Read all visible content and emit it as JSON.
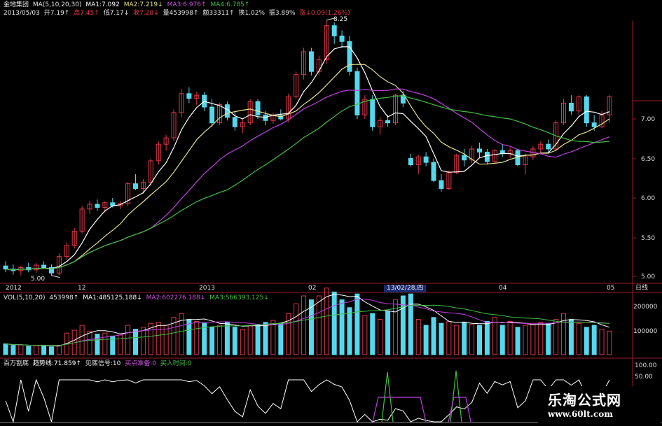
{
  "header": {
    "stock_name": "金地集团",
    "ma_spec": "MA(5,10,20,30)",
    "ma1": "MA1:7.092",
    "ma2": "MA2:7.219↓",
    "ma3": "MA3:6.976↑",
    "ma4": "MA4:6.785↑",
    "date": "2013/05/03",
    "open": "开7.19↑",
    "high": "高7.45↑",
    "low": "低7.17↓",
    "close": "收7.28↓",
    "volume": "量453998↑",
    "amount": "额33311↑",
    "turnover": "换1.02%",
    "amplitude": "振3.89%",
    "change": "涨↓0.09(1.26%)"
  },
  "price_chart": {
    "high_label": "8.25",
    "low_label": "5.00",
    "y_labels": [
      "7.00",
      "6.50",
      "6.00",
      "5.50",
      "5.00"
    ],
    "period_label": "日线"
  },
  "time_axis": {
    "labels": [
      "2012",
      "12",
      "2013",
      "02",
      "04",
      "05"
    ],
    "cursor_date": "13/02/28,四"
  },
  "volume_panel": {
    "spec": "VOL(5,10,20)",
    "value": "453998↑",
    "ma1": "MA1:485125.188↓",
    "ma2": "MA2:602276.188↓",
    "ma3": "MA3:566393.125↓",
    "y_labels": [
      "200000",
      "100000"
    ]
  },
  "indicator_panel": {
    "name": "百万割底",
    "trend": "趋势线:71.859↑",
    "signal": "见底信号:10",
    "buy_prep": "买点准备:0",
    "buy_time": "买入时间:0",
    "y_labels": [
      "100.00",
      "50.00"
    ]
  },
  "watermark": {
    "title": "乐淘公式网",
    "url": "www.60lt.com"
  },
  "colors": {
    "up": "#e0384a",
    "down": "#54d8ee",
    "ma1": "#ffffff",
    "ma2": "#e8e090",
    "ma3": "#c040e0",
    "ma4": "#40c040",
    "axis": "#9b1e28"
  },
  "chart_data": {
    "type": "candlestick",
    "series": [
      {
        "name": "K",
        "values": [
          [
            5.14,
            5.2,
            5.06,
            5.1
          ],
          [
            5.1,
            5.16,
            5.03,
            5.08
          ],
          [
            5.08,
            5.14,
            5.02,
            5.12
          ],
          [
            5.12,
            5.18,
            5.06,
            5.09
          ],
          [
            5.09,
            5.18,
            5.05,
            5.15
          ],
          [
            5.15,
            5.2,
            5.1,
            5.12
          ],
          [
            5.12,
            5.16,
            5.02,
            5.05
          ],
          [
            5.05,
            5.3,
            5.02,
            5.26
          ],
          [
            5.26,
            5.44,
            5.22,
            5.4
          ],
          [
            5.4,
            5.62,
            5.36,
            5.58
          ],
          [
            5.58,
            5.9,
            5.55,
            5.86
          ],
          [
            5.86,
            5.96,
            5.8,
            5.92
          ],
          [
            5.92,
            5.98,
            5.84,
            5.88
          ],
          [
            5.88,
            5.96,
            5.82,
            5.94
          ],
          [
            5.94,
            6.0,
            5.88,
            5.9
          ],
          [
            5.9,
            5.96,
            5.86,
            5.93
          ],
          [
            5.93,
            6.2,
            5.9,
            6.18
          ],
          [
            6.18,
            6.3,
            6.1,
            6.12
          ],
          [
            6.12,
            6.24,
            6.05,
            6.2
          ],
          [
            6.2,
            6.5,
            6.15,
            6.47
          ],
          [
            6.47,
            6.72,
            6.42,
            6.68
          ],
          [
            6.68,
            6.8,
            6.6,
            6.76
          ],
          [
            6.76,
            7.12,
            6.72,
            7.08
          ],
          [
            7.08,
            7.38,
            7.02,
            7.32
          ],
          [
            7.32,
            7.4,
            7.2,
            7.26
          ],
          [
            7.26,
            7.34,
            7.18,
            7.3
          ],
          [
            7.3,
            7.34,
            7.1,
            7.15
          ],
          [
            7.15,
            7.25,
            6.9,
            6.95
          ],
          [
            6.95,
            7.2,
            6.92,
            7.18
          ],
          [
            7.18,
            7.22,
            6.98,
            7.02
          ],
          [
            7.02,
            7.1,
            6.85,
            6.9
          ],
          [
            6.9,
            7.0,
            6.82,
            6.95
          ],
          [
            6.95,
            7.25,
            6.92,
            7.22
          ],
          [
            7.22,
            7.25,
            7.0,
            7.05
          ],
          [
            7.05,
            7.1,
            6.92,
            6.98
          ],
          [
            6.98,
            7.08,
            6.94,
            7.04
          ],
          [
            7.04,
            7.12,
            6.98,
            7.0
          ],
          [
            7.0,
            7.32,
            6.96,
            7.28
          ],
          [
            7.28,
            7.6,
            7.25,
            7.56
          ],
          [
            7.56,
            7.9,
            7.5,
            7.85
          ],
          [
            7.85,
            7.9,
            7.55,
            7.6
          ],
          [
            7.6,
            7.8,
            7.55,
            7.75
          ],
          [
            7.75,
            8.25,
            7.7,
            8.18
          ],
          [
            8.18,
            8.22,
            7.95,
            8.05
          ],
          [
            8.05,
            8.12,
            7.9,
            7.98
          ],
          [
            7.98,
            8.05,
            7.55,
            7.6
          ],
          [
            7.6,
            7.65,
            7.0,
            7.05
          ],
          [
            7.05,
            7.3,
            7.0,
            7.25
          ],
          [
            7.25,
            7.3,
            6.85,
            6.9
          ],
          [
            6.9,
            7.02,
            6.8,
            6.98
          ],
          [
            6.98,
            7.05,
            6.9,
            6.95
          ],
          [
            6.95,
            7.32,
            6.92,
            7.3
          ],
          [
            7.3,
            7.35,
            7.15,
            7.2
          ],
          [
            6.5,
            6.56,
            6.4,
            6.42
          ],
          [
            6.42,
            6.55,
            6.3,
            6.52
          ],
          [
            6.52,
            6.58,
            6.4,
            6.45
          ],
          [
            6.45,
            6.5,
            6.2,
            6.22
          ],
          [
            6.22,
            6.3,
            6.08,
            6.12
          ],
          [
            6.12,
            6.35,
            6.1,
            6.32
          ],
          [
            6.32,
            6.56,
            6.3,
            6.54
          ],
          [
            6.54,
            6.62,
            6.4,
            6.48
          ],
          [
            6.48,
            6.66,
            6.44,
            6.62
          ],
          [
            6.62,
            6.7,
            6.5,
            6.58
          ],
          [
            6.58,
            6.62,
            6.42,
            6.46
          ],
          [
            6.46,
            6.62,
            6.44,
            6.6
          ],
          [
            6.6,
            6.68,
            6.52,
            6.56
          ],
          [
            6.56,
            6.64,
            6.5,
            6.6
          ],
          [
            6.6,
            6.62,
            6.4,
            6.42
          ],
          [
            6.42,
            6.56,
            6.3,
            6.52
          ],
          [
            6.52,
            6.66,
            6.48,
            6.62
          ],
          [
            6.62,
            6.72,
            6.55,
            6.68
          ],
          [
            6.68,
            6.74,
            6.58,
            6.62
          ],
          [
            6.62,
            6.98,
            6.6,
            6.95
          ],
          [
            6.95,
            7.25,
            6.92,
            7.2
          ],
          [
            7.2,
            7.3,
            7.05,
            7.1
          ],
          [
            7.1,
            7.3,
            7.05,
            7.28
          ],
          [
            7.28,
            7.3,
            6.9,
            6.95
          ],
          [
            6.95,
            7.05,
            6.85,
            6.9
          ],
          [
            6.9,
            7.1,
            6.88,
            7.05
          ],
          [
            7.05,
            7.3,
            6.95,
            7.28
          ]
        ]
      },
      {
        "name": "VOL",
        "values": [
          110,
          95,
          100,
          85,
          92,
          88,
          80,
          96,
          220,
          250,
          300,
          240,
          210,
          220,
          190,
          200,
          300,
          260,
          280,
          320,
          330,
          300,
          380,
          420,
          360,
          340,
          320,
          280,
          300,
          330,
          280,
          260,
          300,
          310,
          330,
          350,
          320,
          420,
          520,
          600,
          560,
          600,
          680,
          640,
          560,
          480,
          620,
          400,
          420,
          360,
          440,
          560,
          600,
          620,
          360,
          300,
          380,
          320,
          340,
          300,
          330,
          310,
          300,
          340,
          380,
          300,
          340,
          280,
          300,
          310,
          330,
          320,
          360,
          420,
          360,
          320,
          280,
          300,
          260,
          240
        ]
      }
    ]
  }
}
